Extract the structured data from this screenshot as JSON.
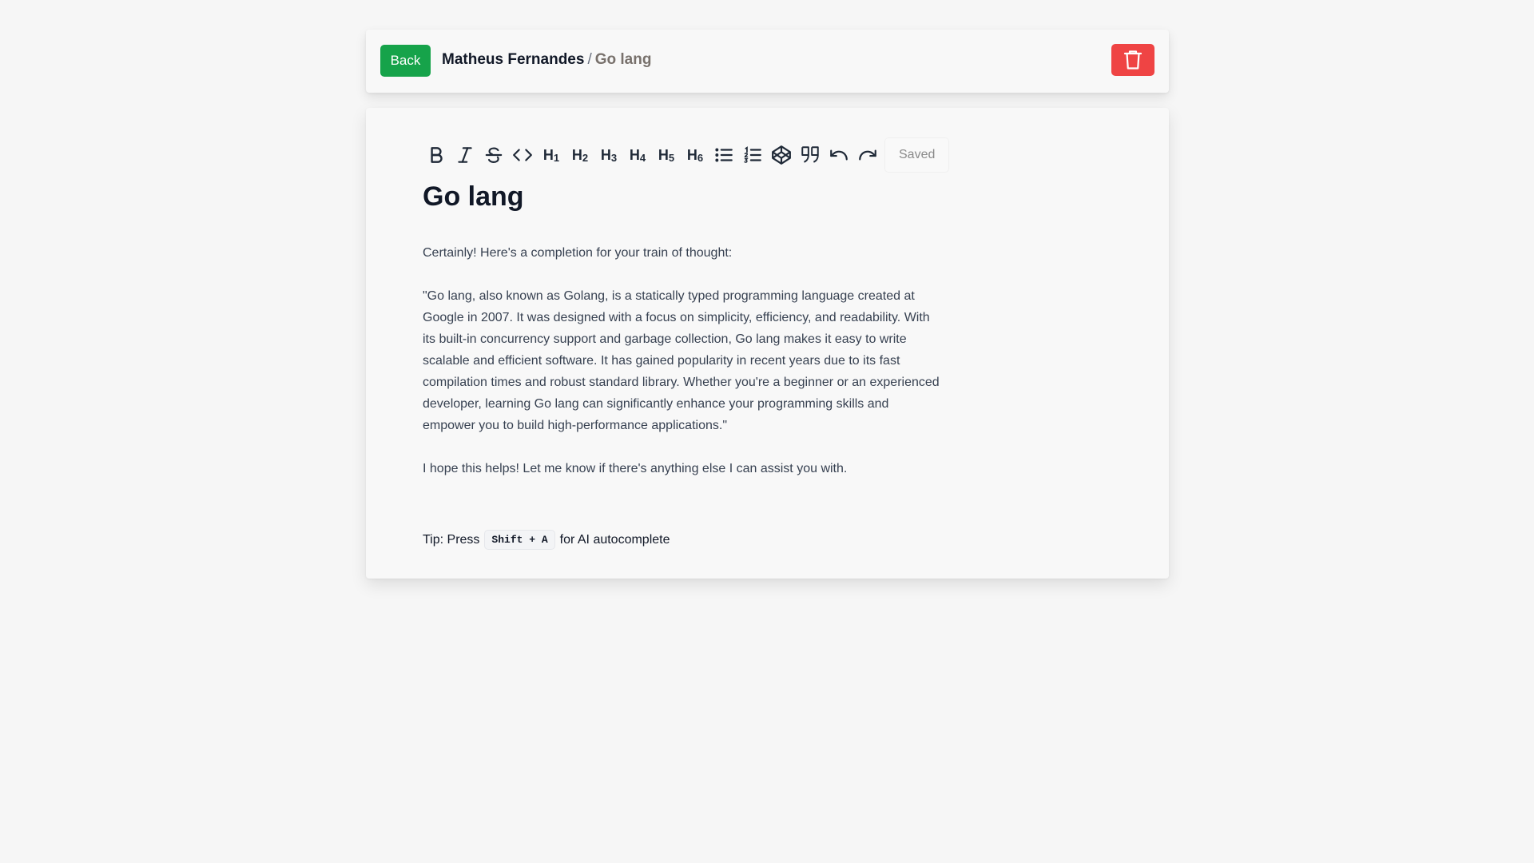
{
  "header": {
    "back_label": "Back",
    "user_name": "Matheus Fernandes",
    "separator": "/",
    "page_name": "Go lang",
    "delete_icon": "trash-icon"
  },
  "toolbar": {
    "items": [
      "bold-icon",
      "italic-icon",
      "strikethrough-icon",
      "code-icon",
      "heading-1-icon",
      "heading-2-icon",
      "heading-3-icon",
      "heading-4-icon",
      "heading-5-icon",
      "heading-6-icon",
      "bullet-list-icon",
      "ordered-list-icon",
      "codepen-icon",
      "quote-icon",
      "undo-icon",
      "redo-icon"
    ],
    "h1": "H",
    "h1_sub": "1",
    "h2": "H",
    "h2_sub": "2",
    "h3": "H",
    "h3_sub": "3",
    "h4": "H",
    "h4_sub": "4",
    "h5": "H",
    "h5_sub": "5",
    "h6": "H",
    "h6_sub": "6",
    "status": "Saved"
  },
  "document": {
    "title": "Go lang",
    "paragraphs": [
      "Certainly! Here's a completion for your train of thought:",
      "\"Go lang, also known as Golang, is a statically typed programming language created at Google in 2007. It was designed with a focus on simplicity, efficiency, and readability. With its built-in concurrency support and garbage collection, Go lang makes it easy to write scalable and efficient software. It has gained popularity in recent years due to its fast compilation times and robust standard library. Whether you're a beginner or an experienced developer, learning Go lang can significantly enhance your programming skills and empower you to build high-performance applications.\"",
      "I hope this helps! Let me know if there's anything else I can assist you with."
    ]
  },
  "tip": {
    "prefix": "Tip: Press",
    "shortcut": "Shift + A",
    "suffix": "for AI autocomplete"
  },
  "colors": {
    "back_button": "#16a34a",
    "delete_button": "#ef4444",
    "background": "#f6f6f6"
  }
}
